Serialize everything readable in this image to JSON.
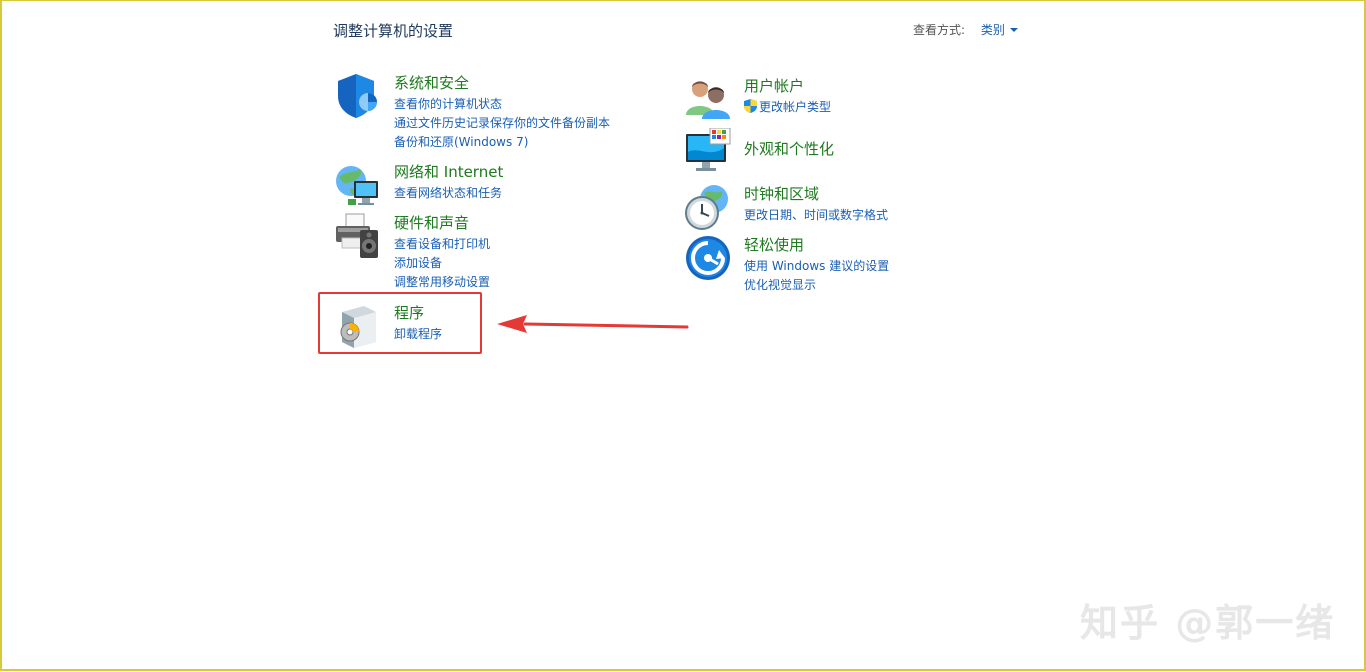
{
  "header": {
    "title": "调整计算机的设置",
    "view_by_label": "查看方式:",
    "view_by_value": "类别"
  },
  "categories": [
    {
      "title": "系统和安全",
      "icon": "shield-icon",
      "links": [
        "查看你的计算机状态",
        "通过文件历史记录保存你的文件备份副本",
        "备份和还原(Windows 7)"
      ]
    },
    {
      "title": "网络和 Internet",
      "icon": "network-globe-icon",
      "links": [
        "查看网络状态和任务"
      ]
    },
    {
      "title": "硬件和声音",
      "icon": "printer-speaker-icon",
      "links": [
        "查看设备和打印机",
        "添加设备",
        "调整常用移动设置"
      ]
    },
    {
      "title": "程序",
      "icon": "programs-disc-icon",
      "links": [
        "卸载程序"
      ]
    },
    {
      "title": "用户帐户",
      "icon": "users-icon",
      "links": [
        "更改帐户类型"
      ]
    },
    {
      "title": "外观和个性化",
      "icon": "monitor-palette-icon",
      "links": []
    },
    {
      "title": "时钟和区域",
      "icon": "clock-globe-icon",
      "links": [
        "更改日期、时间或数字格式"
      ]
    },
    {
      "title": "轻松使用",
      "icon": "ease-of-access-icon",
      "links": [
        "使用 Windows 建议的设置",
        "优化视觉显示"
      ]
    }
  ],
  "colors": {
    "category_title": "#1e7a1e",
    "link": "#1a5fb4",
    "annotation": "#e53935"
  },
  "watermark": "知乎 @郭一绪"
}
